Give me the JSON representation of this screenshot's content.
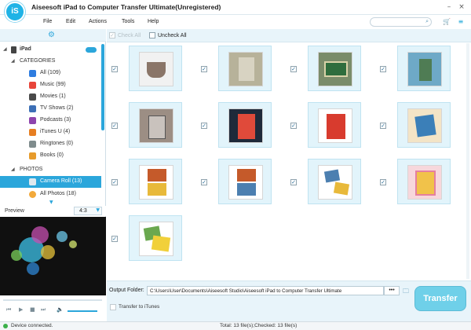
{
  "window": {
    "title": "Aiseesoft iPad to Computer Transfer Ultimate(Unregistered)",
    "minimize_glyph": "–",
    "close_glyph": "×"
  },
  "menu": {
    "items": [
      "File",
      "Edit",
      "Actions",
      "Tools",
      "Help"
    ]
  },
  "toolbar": {
    "search_placeholder": "",
    "cart_icon": "cart-icon",
    "menu_icon": "menu-icon"
  },
  "sidebar": {
    "device": "iPad",
    "categories_header": "CATEGORIES",
    "categories": [
      {
        "label": "All (109)",
        "color": "#2e7de0"
      },
      {
        "label": "Music (99)",
        "color": "#e8453a"
      },
      {
        "label": "Movies (1)",
        "color": "#4a4a4a"
      },
      {
        "label": "TV Shows (2)",
        "color": "#3c6fb6"
      },
      {
        "label": "Podcasts (3)",
        "color": "#8e44ad"
      },
      {
        "label": "iTunes U (4)",
        "color": "#e67e22"
      },
      {
        "label": "Ringtones (0)",
        "color": "#7f8c8d"
      },
      {
        "label": "Books (0)",
        "color": "#e79b2b"
      }
    ],
    "photos_header": "PHOTOS",
    "photos": [
      {
        "label": "Camera Roll (13)",
        "selected": true
      },
      {
        "label": "All Photos (18)",
        "selected": false
      }
    ]
  },
  "preview": {
    "label": "Preview",
    "ratio": "4:3",
    "volume_level": 0.9
  },
  "main": {
    "check_all": "Check All",
    "uncheck_all": "Uncheck All",
    "items_checked": [
      true,
      true,
      true,
      true,
      true,
      true,
      true,
      true,
      true,
      true,
      true,
      true,
      true
    ]
  },
  "bottom": {
    "output_label": "Output Folder:",
    "output_path": "C:\\Users\\User\\Documents\\Aiseesoft Studio\\Aiseesoft iPad to Computer Transfer Ultimate",
    "browse": "•••",
    "transfer_button": "Transfer",
    "transfer_to_itunes": "Transfer to iTunes"
  },
  "status": {
    "connection": "Device connected.",
    "summary": "Total: 13 file(s);Checked: 13 file(s)"
  },
  "colors": {
    "accent": "#2ba6db",
    "tile_bg": "#e2f4fb",
    "transfer_btn": "#6fd0e9"
  }
}
